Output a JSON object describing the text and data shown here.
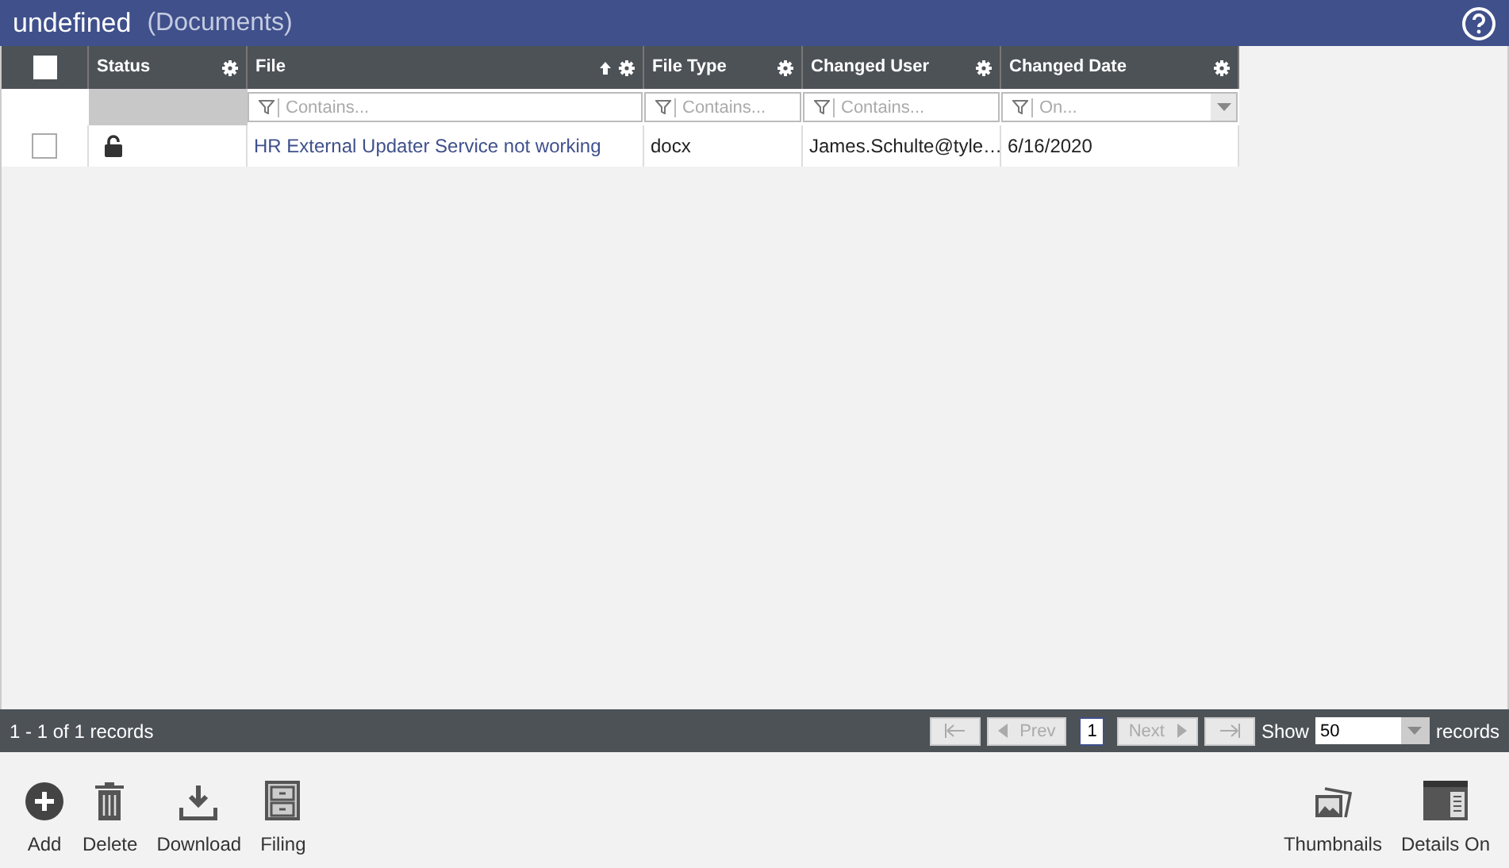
{
  "header": {
    "title": "undefined",
    "subtitle": "(Documents)"
  },
  "grid": {
    "select_all": {
      "checked": false
    },
    "columns": [
      {
        "label": "Status",
        "sorted": false
      },
      {
        "label": "File",
        "sorted": true,
        "filter": {
          "kind": "text",
          "placeholder": "Contains..."
        }
      },
      {
        "label": "File Type",
        "sorted": false,
        "filter": {
          "kind": "text",
          "placeholder": "Contains..."
        }
      },
      {
        "label": "Changed User",
        "sorted": false,
        "filter": {
          "kind": "text",
          "placeholder": "Contains..."
        }
      },
      {
        "label": "Changed Date",
        "sorted": false,
        "filter": {
          "kind": "date",
          "placeholder": "On..."
        }
      }
    ],
    "rows": [
      {
        "checked": false,
        "file": "HR External Updater Service not working",
        "file_type": "docx",
        "changed_user": "James.Schulte@tyle…",
        "changed_date": "6/16/2020"
      }
    ]
  },
  "footer": {
    "summary": "1 - 1 of 1 records",
    "prev": "Prev",
    "next": "Next",
    "page": "1",
    "show_label": "Show",
    "page_size": "50",
    "records_label": "records"
  },
  "toolbar": {
    "left": [
      {
        "label": "Add"
      },
      {
        "label": "Delete"
      },
      {
        "label": "Download"
      },
      {
        "label": "Filing"
      }
    ],
    "right": [
      {
        "label": "Thumbnails"
      },
      {
        "label": "Details On"
      }
    ]
  }
}
